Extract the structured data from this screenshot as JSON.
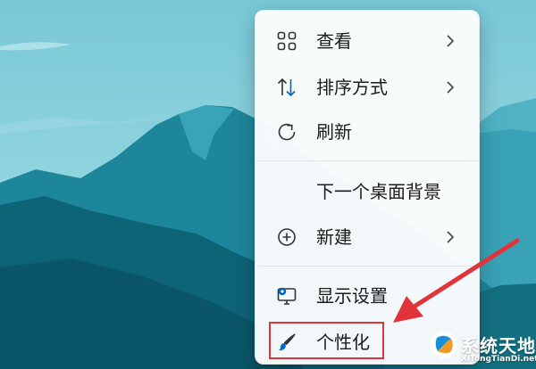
{
  "context_menu": {
    "items": [
      {
        "label": "查看",
        "icon": "grid-view-icon",
        "has_submenu": true
      },
      {
        "label": "排序方式",
        "icon": "sort-arrows-icon",
        "has_submenu": true
      },
      {
        "label": "刷新",
        "icon": "refresh-icon",
        "has_submenu": false
      },
      {
        "label": "下一个桌面背景",
        "icon": "",
        "has_submenu": false
      },
      {
        "label": "新建",
        "icon": "new-plus-icon",
        "has_submenu": true
      },
      {
        "label": "显示设置",
        "icon": "display-settings-icon",
        "has_submenu": false
      },
      {
        "label": "个性化",
        "icon": "brush-icon",
        "has_submenu": false
      }
    ],
    "highlighted_item": "个性化"
  },
  "watermark": {
    "title": "系统天地",
    "subtitle": "XiTongTianDi.net"
  },
  "colors": {
    "annotation": "#e0343a",
    "sky": "#8ed4e0",
    "mountain_dark": "#0e6b80",
    "mountain_mid": "#2f8fa3",
    "icon_accent": "#0067c0"
  }
}
